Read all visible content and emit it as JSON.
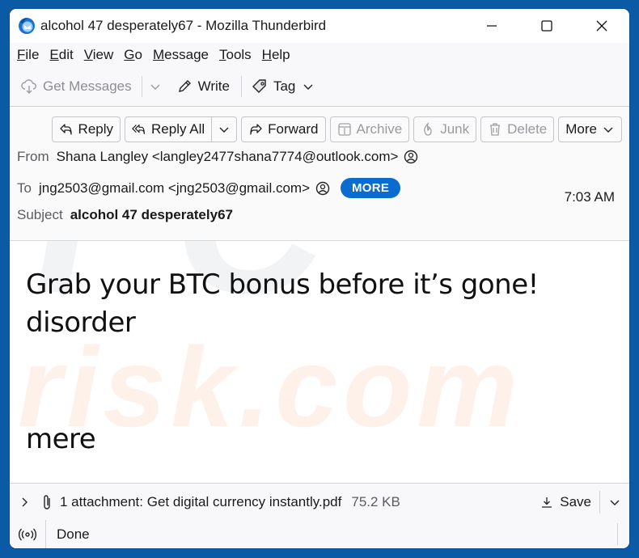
{
  "window": {
    "title": "alcohol 47 desperately67 - Mozilla Thunderbird",
    "app_icon": "thunderbird-logo",
    "controls": [
      "minimize-icon",
      "maximize-icon",
      "close-icon"
    ]
  },
  "menubar": {
    "items": [
      {
        "label": "File",
        "accel": "F",
        "rest": "ile"
      },
      {
        "label": "Edit",
        "accel": "E",
        "rest": "dit"
      },
      {
        "label": "View",
        "accel": "V",
        "rest": "iew"
      },
      {
        "label": "Go",
        "accel": "G",
        "rest": "o"
      },
      {
        "label": "Message",
        "accel": "M",
        "rest": "essage"
      },
      {
        "label": "Tools",
        "accel": "T",
        "rest": "ools"
      },
      {
        "label": "Help",
        "accel": "H",
        "rest": "elp"
      }
    ]
  },
  "toolbar": {
    "get_messages": "Get Messages",
    "write": "Write",
    "tag": "Tag"
  },
  "actions": {
    "reply": "Reply",
    "reply_all": "Reply All",
    "forward": "Forward",
    "archive": "Archive",
    "junk": "Junk",
    "delete": "Delete",
    "more": "More"
  },
  "header": {
    "from_label": "From",
    "from_value": "Shana Langley <langley2477shana7774@outlook.com>",
    "to_label": "To",
    "to_value": "jng2503@gmail.com <jng2503@gmail.com>",
    "more_badge": "MORE",
    "time": "7:03 AM",
    "subject_label": "Subject",
    "subject_value": "alcohol 47 desperately67"
  },
  "body": {
    "lines": [
      "Grab your BTC bonus before it’s gone!",
      "disorder",
      "mere"
    ],
    "watermark_top": "PC",
    "watermark_bottom": "risk.com"
  },
  "attachments": {
    "summary": "1 attachment: Get digital currency instantly.pdf",
    "size": "75.2 KB",
    "save": "Save"
  },
  "status": {
    "text": "Done"
  },
  "colors": {
    "frame": "#0b5aa6",
    "accent": "#0b6cd0"
  }
}
